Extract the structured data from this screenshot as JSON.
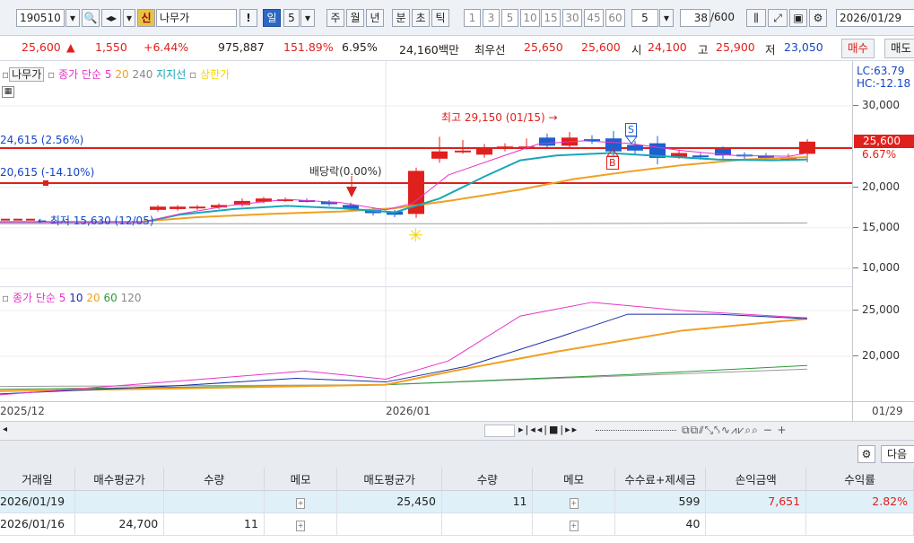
{
  "toolbar": {
    "code": "190510",
    "new_badge": "신",
    "name": "나무가",
    "day": "일",
    "period": "5",
    "week": "주",
    "month": "월",
    "year": "년",
    "minute": "분",
    "second": "초",
    "tick": "틱",
    "intervals": [
      "1",
      "3",
      "5",
      "10",
      "15",
      "30",
      "45",
      "60"
    ],
    "interval_value": "5",
    "count": "38",
    "count_total": "/600",
    "date": "2026/01/29"
  },
  "quote": {
    "price": "25,600",
    "arrow": "▲",
    "change": "1,550",
    "change_pct": "+6.44%",
    "volume": "975,887",
    "vol_ratio": "151.89%",
    "turnover": "6.95%",
    "amount": "24,160백만",
    "best_label": "최우선",
    "best_ask": "25,650",
    "best_bid": "25,600",
    "open_label": "시",
    "open": "24,100",
    "high_label": "고",
    "high": "25,900",
    "low_label": "저",
    "low": "23,050",
    "buy": "매수",
    "sell": "매도"
  },
  "price_legend": {
    "name": "나무가",
    "ma": "종가 단순 5",
    "ma20": "20",
    "ma240": "240",
    "support": "지지선",
    "upper": "상한가"
  },
  "vol_legend": {
    "ma": "종가 단순 5",
    "a": "10",
    "b": "20",
    "c": "60",
    "d": "120"
  },
  "annotations": {
    "hline1": "24,615 (2.56%)",
    "hline2": "20,615 (-14.10%)",
    "dividend": "배당락(0.00%)",
    "high": "최고 29,150 (01/15) →",
    "low": "← 최저 15,630 (12/05)",
    "sell_mark": "S",
    "buy_mark": "B"
  },
  "axis": {
    "lc": "LC:63.79",
    "hc": "HC:-12.18",
    "price_ticks": [
      "30,000",
      "25,000",
      "20,000",
      "15,000",
      "10,000"
    ],
    "current": "25,600",
    "current_pct": "6.67%",
    "vol_ticks": [
      "25,000",
      "20,000"
    ],
    "x_labels": [
      "2025/12",
      "2026/01"
    ],
    "x_right": "01/29"
  },
  "table": {
    "settings": "⚙",
    "next": "다음",
    "headers": [
      "거래일",
      "매수평균가",
      "수량",
      "메모",
      "매도평균가",
      "수량",
      "메모",
      "수수료+제세금",
      "손익금액",
      "수익률"
    ],
    "rows": [
      [
        "2026/01/19",
        "",
        "",
        "",
        "25,450",
        "11",
        "",
        "599",
        "7,651",
        "2.82%"
      ],
      [
        "2026/01/16",
        "24,700",
        "11",
        "",
        "",
        "",
        "",
        "40",
        "",
        ""
      ]
    ]
  },
  "colors": {
    "up": "#e0201c",
    "down": "#1e5fd0",
    "ma5": "#e535c8",
    "ma20": "#f0a020",
    "ma10": "#1a2fa8",
    "ma60": "#2a9a3a",
    "support": "#19a7b8"
  }
}
